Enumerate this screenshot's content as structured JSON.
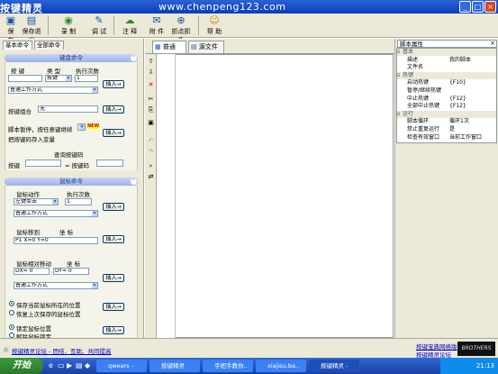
{
  "window": {
    "title": "按键精灵",
    "watermark": "www.chenpeng123.com"
  },
  "toolbar": {
    "save": "保 存",
    "save_exit": "保存退出",
    "record": "录 制",
    "debug": "调 试",
    "comment": "注 释",
    "attach": "附 件",
    "pick_color": "抓点抓色",
    "help": "帮 助"
  },
  "left": {
    "tab_basic": "基本命令",
    "tab_all": "全部命令",
    "kb_section": "键盘命令",
    "key_label": "按 键",
    "type_label": "类 型",
    "exec_count_label": "执行次数",
    "type_value": "按键",
    "count_value": "1",
    "mode_value": "普通工作方式",
    "insert": "插入→",
    "combo_label": "按键组合",
    "combo_value": "无",
    "pause_label": "脚本暂停，按任意键继续",
    "new_badge": "NEW",
    "save_var_label": "把按键码存入变量",
    "query_label": "查询按键码",
    "query_key": "按键",
    "query_code": "= 按键码",
    "mouse_section": "鼠标命令",
    "action_label": "鼠标动作",
    "mouse_count_label": "执行次数",
    "action_value": "左键单击",
    "mouse_count_value": "1",
    "mouse_mode_value": "普通工作方式",
    "move_label": "鼠标移到",
    "coord_label": "坐 标",
    "move_value": "P1 X=0 Y=0",
    "rel_label": "鼠标相对移动",
    "rel_coord_label": "坐 标",
    "dx_value": "DX= 0",
    "dy_value": "DY= 0",
    "rel_mode_value": "普通工作方式",
    "radio1": "保存当前鼠标所在的位置",
    "radio2": "恢复上次保存的鼠标位置",
    "radio3": "锁定鼠标位置",
    "radio4": "解除鼠标锁定"
  },
  "editor": {
    "tab_normal": "普通",
    "tab_source": "源文件"
  },
  "props": {
    "title": "脚本属性",
    "rows": [
      {
        "cat": true,
        "k": "基本"
      },
      {
        "k": "描述",
        "v": "我的脚本"
      },
      {
        "k": "文件名",
        "v": ""
      },
      {
        "cat": true,
        "k": "热键"
      },
      {
        "k": "启动热键",
        "v": "{F10}"
      },
      {
        "k": "暂停/继续热键",
        "v": ""
      },
      {
        "k": "中止热键",
        "v": "{F12}"
      },
      {
        "k": "全部中止热键",
        "v": "{F12}"
      },
      {
        "cat": true,
        "k": "运行"
      },
      {
        "k": "脚本循环",
        "v": "循环1次"
      },
      {
        "k": "禁止重复运行",
        "v": "是"
      },
      {
        "k": "检查有效窗口",
        "v": "当前工作窗口"
      }
    ]
  },
  "status": {
    "forum": "按键精灵论坛 - 团结、互助、共同提高",
    "bottom_right1": "按键宝典网络版",
    "bottom_right2": "按键精灵论坛",
    "brand": "BROTHERS"
  },
  "taskbar": {
    "start": "开始",
    "t1": "qwears -",
    "t2": "按键精灵",
    "t3": "手把手教你..",
    "t4": "xiajisu.ba..",
    "t5": "按键精灵 -",
    "clock": "21:13"
  }
}
